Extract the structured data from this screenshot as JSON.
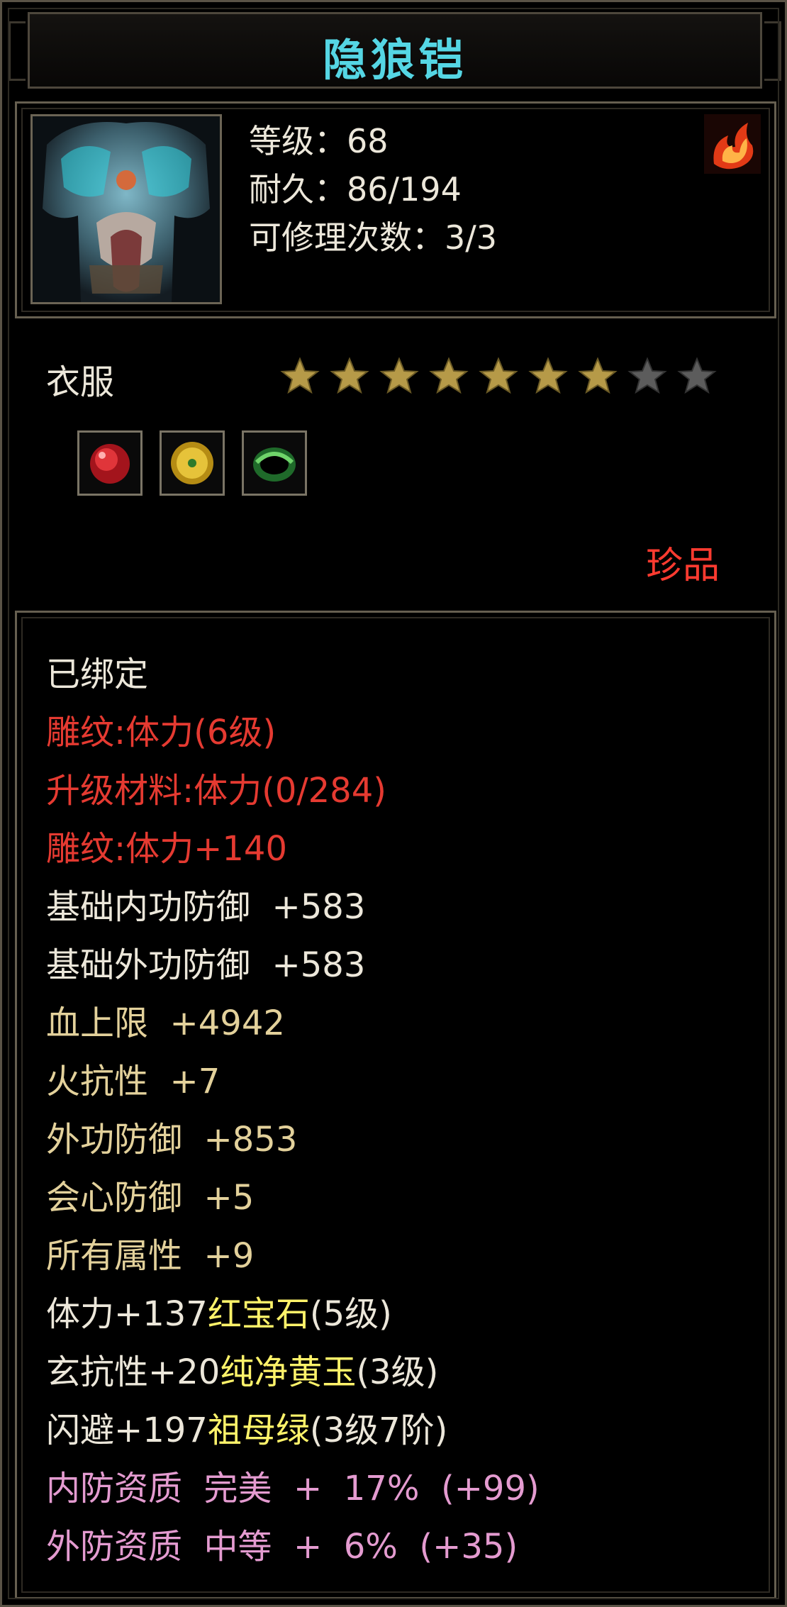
{
  "item": {
    "name": "隐狼铠",
    "level": "等级：68",
    "durability": "耐久：86/194",
    "repair": "可修理次数：3/3",
    "slot": "衣服",
    "stars": {
      "filled": 7,
      "total": 9
    },
    "rarity": "珍品",
    "gems": [
      "red-gem-icon",
      "yellow-jade-icon",
      "emerald-icon"
    ]
  },
  "colors": {
    "title": "#55d6e4",
    "white": "#ece7da",
    "red": "#e53a31",
    "gold": "#e3d19b",
    "pink": "#e49bd0",
    "yellow": "#fff36a",
    "rarity": "#ff3b30"
  },
  "attributes": {
    "bound": "已绑定",
    "carving": "雕纹:体力(6级)",
    "upgrade": "升级材料:体力(0/284)",
    "carving_bonus": "雕纹:体力+140",
    "base_inner_def": "基础内功防御  +583",
    "base_outer_def": "基础外功防御  +583",
    "hp_max": "血上限  +4942",
    "fire_res": "火抗性  +7",
    "outer_def": "外功防御  +853",
    "crit_def": "会心防御  +5",
    "all_attr": "所有属性  +9",
    "gem1_stat": "体力+137",
    "gem1_name": "红宝石",
    "gem1_lvl": "(5级)",
    "gem2_stat": "玄抗性+20",
    "gem2_name": "纯净黄玉",
    "gem2_lvl": "(3级)",
    "gem3_stat": "闪避+197",
    "gem3_name": "祖母绿",
    "gem3_lvl": "(3级7阶)",
    "inner_quality": "内防资质  完美  +  17%  (+99)",
    "outer_quality": "外防资质  中等  +  6%  (+35)"
  }
}
